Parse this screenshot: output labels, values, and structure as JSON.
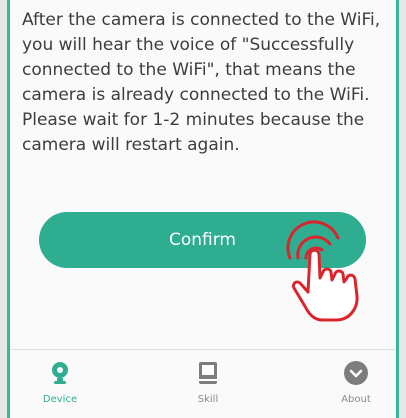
{
  "instruction": {
    "text": "After the camera is connected to the WiFi, you will hear the voice of \"Successfully connected to the WiFi\", that means the camera is already connected to the WiFi. Please wait for 1-2 minutes because the camera will restart again."
  },
  "confirm": {
    "label": "Confirm"
  },
  "tabs": [
    {
      "label": "Device",
      "icon": "camera-icon",
      "active": true
    },
    {
      "label": "Skill",
      "icon": "book-icon",
      "active": false
    },
    {
      "label": "About",
      "icon": "chevron-circle-icon",
      "active": false
    }
  ],
  "colors": {
    "accent": "#2fad91",
    "text": "#3d3d3d",
    "inactive_tab": "#8a8a8a",
    "hand_outline": "#d9262c"
  }
}
